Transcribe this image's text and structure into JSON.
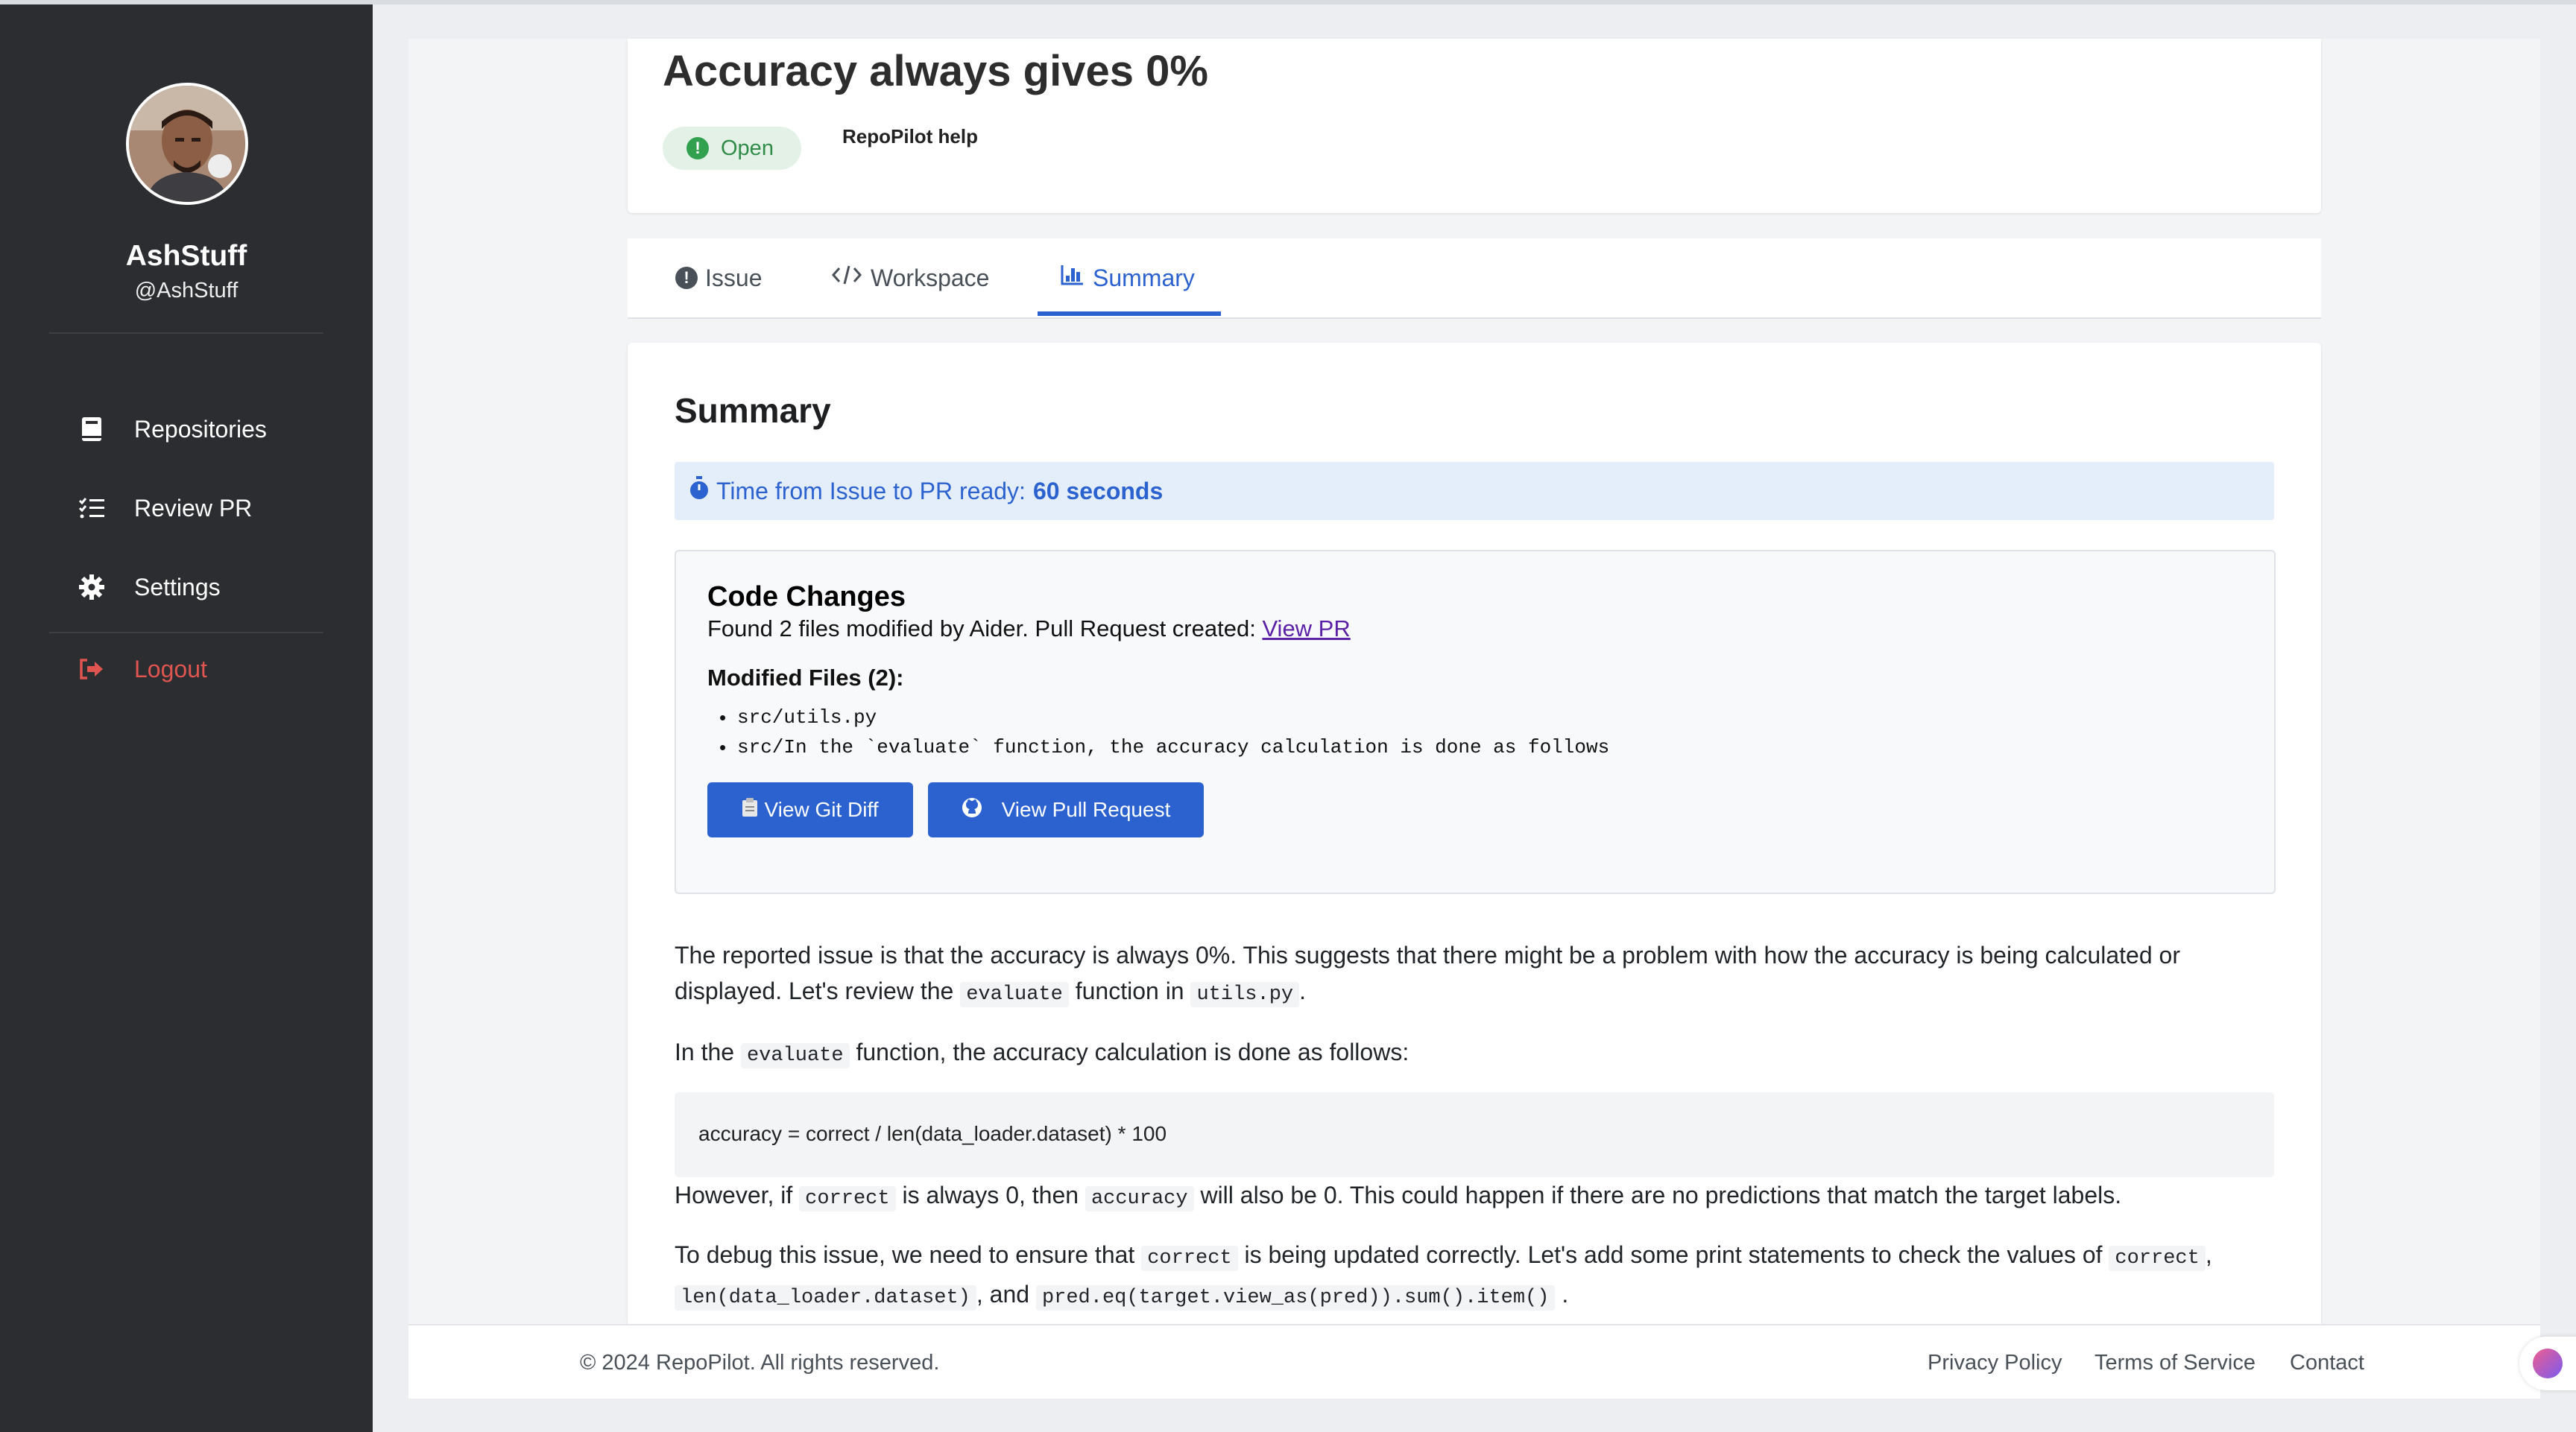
{
  "user": {
    "name": "AshStuff",
    "handle": "@AshStuff"
  },
  "sidebar": {
    "items": [
      {
        "label": "Repositories",
        "icon": "book-icon"
      },
      {
        "label": "Review PR",
        "icon": "list-check-icon"
      },
      {
        "label": "Settings",
        "icon": "gear-icon"
      },
      {
        "label": "Logout",
        "icon": "logout-icon"
      }
    ]
  },
  "issue": {
    "title": "Accuracy always gives 0%",
    "status": "Open",
    "helper": "RepoPilot help"
  },
  "tabs": [
    {
      "label": "Issue"
    },
    {
      "label": "Workspace"
    },
    {
      "label": "Summary",
      "active": true
    }
  ],
  "summary": {
    "heading": "Summary",
    "time_label": "Time from Issue to PR ready:",
    "time_value": "60 seconds",
    "code_changes": {
      "title": "Code Changes",
      "found_text": "Found 2 files modified by Aider. Pull Request created:",
      "view_pr_link": "View PR",
      "modified_title": "Modified Files (2):",
      "files": [
        "src/utils.py",
        "src/In the `evaluate` function, the accuracy calculation is done as follows"
      ],
      "git_diff_button": "View Git Diff",
      "pull_request_button": "View Pull Request"
    },
    "para1_a": "The reported issue is that the accuracy is always 0%. This suggests that there might be a problem with how the accuracy is being calculated or",
    "para1_b1": "displayed. Let's review the",
    "para1_code1": "evaluate",
    "para1_b2": "function in",
    "para1_code2": "utils.py",
    "para1_b3": ".",
    "para2_a": "In the",
    "para2_code": "evaluate",
    "para2_b": "function, the accuracy calculation is done as follows:",
    "code_line": "accuracy  =  correct  /  len(data_loader.dataset)  *  100",
    "para3_a": "However, if",
    "para3_code1": "correct",
    "para3_b": "is always 0, then",
    "para3_code2": "accuracy",
    "para3_c": "will also be 0. This could happen if there are no predictions that match the target labels.",
    "para4_a": "To debug this issue, we need to ensure that",
    "para4_code1": "correct",
    "para4_b": "is being updated correctly. Let's add some print statements to check the values of",
    "para4_code2": "correct",
    "para4_c": ",",
    "para4_code3": "len(data_loader.dataset)",
    "para4_d": ", and",
    "para4_code4": "pred.eq(target.view_as(pred)).sum().item()",
    "para4_e": "."
  },
  "footer": {
    "copyright": "© 2024 RepoPilot. All rights reserved.",
    "links": [
      "Privacy Policy",
      "Terms of Service",
      "Contact"
    ]
  },
  "colors": {
    "sidebar": "#2b2d31",
    "accent": "#2b62cf",
    "logout": "#e0554f",
    "open_badge": "#2f8b47"
  }
}
